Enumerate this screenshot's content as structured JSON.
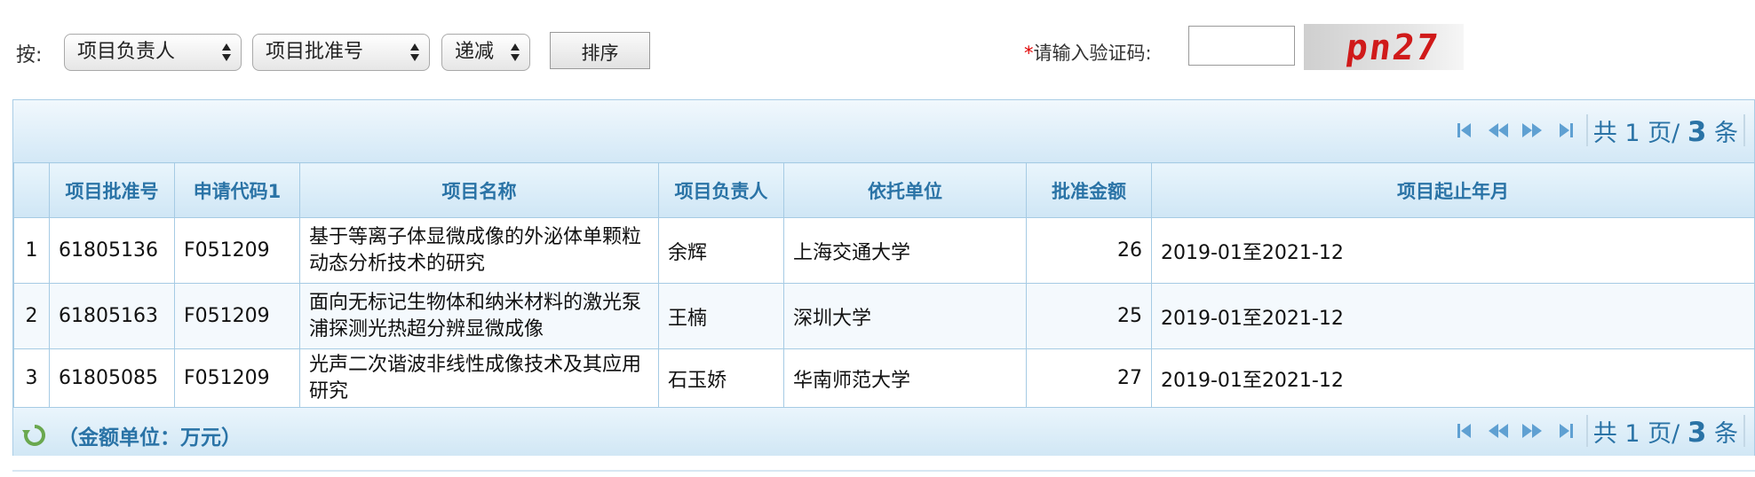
{
  "filter": {
    "sort_by_label": "按:",
    "select_field": "项目负责人",
    "select_field2": "项目批准号",
    "select_order": "递减",
    "sort_button": "排序",
    "captcha_label": "请输入验证码:",
    "captcha_required_mark": "*",
    "captcha_value": "",
    "captcha_image_text": "pn27"
  },
  "pager": {
    "prefix": "共",
    "pages": "1",
    "pages_suffix": "页/",
    "records": "3",
    "records_suffix": "条"
  },
  "table": {
    "columns": [
      "项目批准号",
      "申请代码1",
      "项目名称",
      "项目负责人",
      "依托单位",
      "批准金额",
      "项目起止年月"
    ],
    "rows": [
      {
        "index": "1",
        "approval_no": "61805136",
        "code": "F051209",
        "name": "基于等离子体显微成像的外泌体单颗粒动态分析技术的研究",
        "leader": "余辉",
        "unit": "上海交通大学",
        "amount": "26",
        "period": "2019-01至2021-12"
      },
      {
        "index": "2",
        "approval_no": "61805163",
        "code": "F051209",
        "name": "面向无标记生物体和纳米材料的激光泵浦探测光热超分辨显微成像",
        "leader": "王楠",
        "unit": "深圳大学",
        "amount": "25",
        "period": "2019-01至2021-12"
      },
      {
        "index": "3",
        "approval_no": "61805085",
        "code": "F051209",
        "name": "光声二次谐波非线性成像技术及其应用研究",
        "leader": "石玉娇",
        "unit": "华南师范大学",
        "amount": "27",
        "period": "2019-01至2021-12"
      }
    ]
  },
  "footer": {
    "unit_note": "（金额单位：万元）"
  },
  "icons": {
    "first": "first-page-icon",
    "prev": "prev-page-icon",
    "next": "next-page-icon",
    "last": "last-page-icon",
    "refresh": "refresh-icon",
    "select_arrows": "updown-arrows-icon"
  },
  "colors": {
    "accent_blue": "#2a73a6",
    "header_bg": "#d3e8f6",
    "border": "#a6cbe4",
    "required_red": "#e00000",
    "captcha_red": "#d01a1a"
  }
}
